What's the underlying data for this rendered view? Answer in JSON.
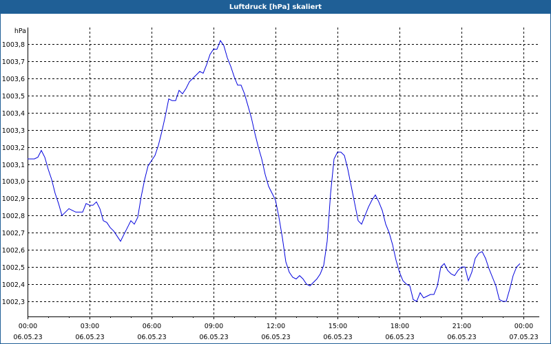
{
  "window": {
    "title": "Luftdruck [hPa] skaliert"
  },
  "colors": {
    "titlebar": "#1f5f96",
    "line": "#0000dd",
    "grid": "#000000"
  },
  "chart_data": {
    "type": "line",
    "title": "Luftdruck [hPa] skaliert",
    "ylabel": "hPa",
    "xlabel": "",
    "ylim": [
      1002.212,
      1003.896
    ],
    "xlim_hours": [
      0,
      24.77
    ],
    "yticks": [
      1002.3,
      1002.4,
      1002.5,
      1002.6,
      1002.7,
      1002.8,
      1002.9,
      1003.0,
      1003.1,
      1003.2,
      1003.3,
      1003.4,
      1003.5,
      1003.6,
      1003.7,
      1003.8
    ],
    "ytick_labels": [
      "1002,3",
      "1002,4",
      "1002,5",
      "1002,6",
      "1002,7",
      "1002,8",
      "1002,9",
      "1003,0",
      "1003,1",
      "1003,2",
      "1003,3",
      "1003,4",
      "1003,5",
      "1003,6",
      "1003,7",
      "1003,8"
    ],
    "xticks_hours": [
      0,
      3,
      6,
      9,
      12,
      15,
      18,
      21,
      24
    ],
    "xtick_labels": [
      {
        "time": "00:00",
        "date": "06.05.23"
      },
      {
        "time": "03:00",
        "date": "06.05.23"
      },
      {
        "time": "06:00",
        "date": "06.05.23"
      },
      {
        "time": "09:00",
        "date": "06.05.23"
      },
      {
        "time": "12:00",
        "date": "06.05.23"
      },
      {
        "time": "15:00",
        "date": "06.05.23"
      },
      {
        "time": "18:00",
        "date": "06.05.23"
      },
      {
        "time": "21:00",
        "date": "06.05.23"
      },
      {
        "time": "00:00",
        "date": "07.05.23"
      }
    ],
    "grid": true,
    "series": [
      {
        "name": "Luftdruck",
        "start_hour": 0,
        "interval_minutes": 10,
        "values": [
          1003.13,
          1003.13,
          1003.13,
          1003.14,
          1003.18,
          1003.14,
          1003.07,
          1003.01,
          1002.93,
          1002.87,
          1002.8,
          1002.82,
          1002.84,
          1002.83,
          1002.82,
          1002.82,
          1002.82,
          1002.87,
          1002.86,
          1002.86,
          1002.88,
          1002.84,
          1002.77,
          1002.76,
          1002.73,
          1002.71,
          1002.68,
          1002.65,
          1002.69,
          1002.73,
          1002.77,
          1002.75,
          1002.79,
          1002.91,
          1003.01,
          1003.09,
          1003.12,
          1003.15,
          1003.21,
          1003.29,
          1003.38,
          1003.48,
          1003.47,
          1003.47,
          1003.53,
          1003.51,
          1003.54,
          1003.58,
          1003.6,
          1003.62,
          1003.64,
          1003.63,
          1003.68,
          1003.74,
          1003.77,
          1003.77,
          1003.82,
          1003.79,
          1003.72,
          1003.67,
          1003.61,
          1003.56,
          1003.56,
          1003.51,
          1003.44,
          1003.37,
          1003.28,
          1003.2,
          1003.13,
          1003.04,
          1002.97,
          1002.93,
          1002.89,
          1002.79,
          1002.67,
          1002.53,
          1002.47,
          1002.44,
          1002.43,
          1002.45,
          1002.43,
          1002.4,
          1002.39,
          1002.41,
          1002.43,
          1002.46,
          1002.51,
          1002.65,
          1002.93,
          1003.13,
          1003.17,
          1003.17,
          1003.15,
          1003.07,
          1002.97,
          1002.87,
          1002.77,
          1002.75,
          1002.8,
          1002.85,
          1002.89,
          1002.92,
          1002.88,
          1002.83,
          1002.75,
          1002.7,
          1002.63,
          1002.54,
          1002.47,
          1002.42,
          1002.4,
          1002.39,
          1002.31,
          1002.3,
          1002.35,
          1002.32,
          1002.33,
          1002.34,
          1002.34,
          1002.39,
          1002.5,
          1002.52,
          1002.48,
          1002.46,
          1002.45,
          1002.48,
          1002.5,
          1002.5,
          1002.42,
          1002.47,
          1002.55,
          1002.58,
          1002.59,
          1002.55,
          1002.49,
          1002.44,
          1002.39,
          1002.31,
          1002.3,
          1002.3,
          1002.37,
          1002.45,
          1002.5,
          1002.52
        ]
      }
    ]
  }
}
